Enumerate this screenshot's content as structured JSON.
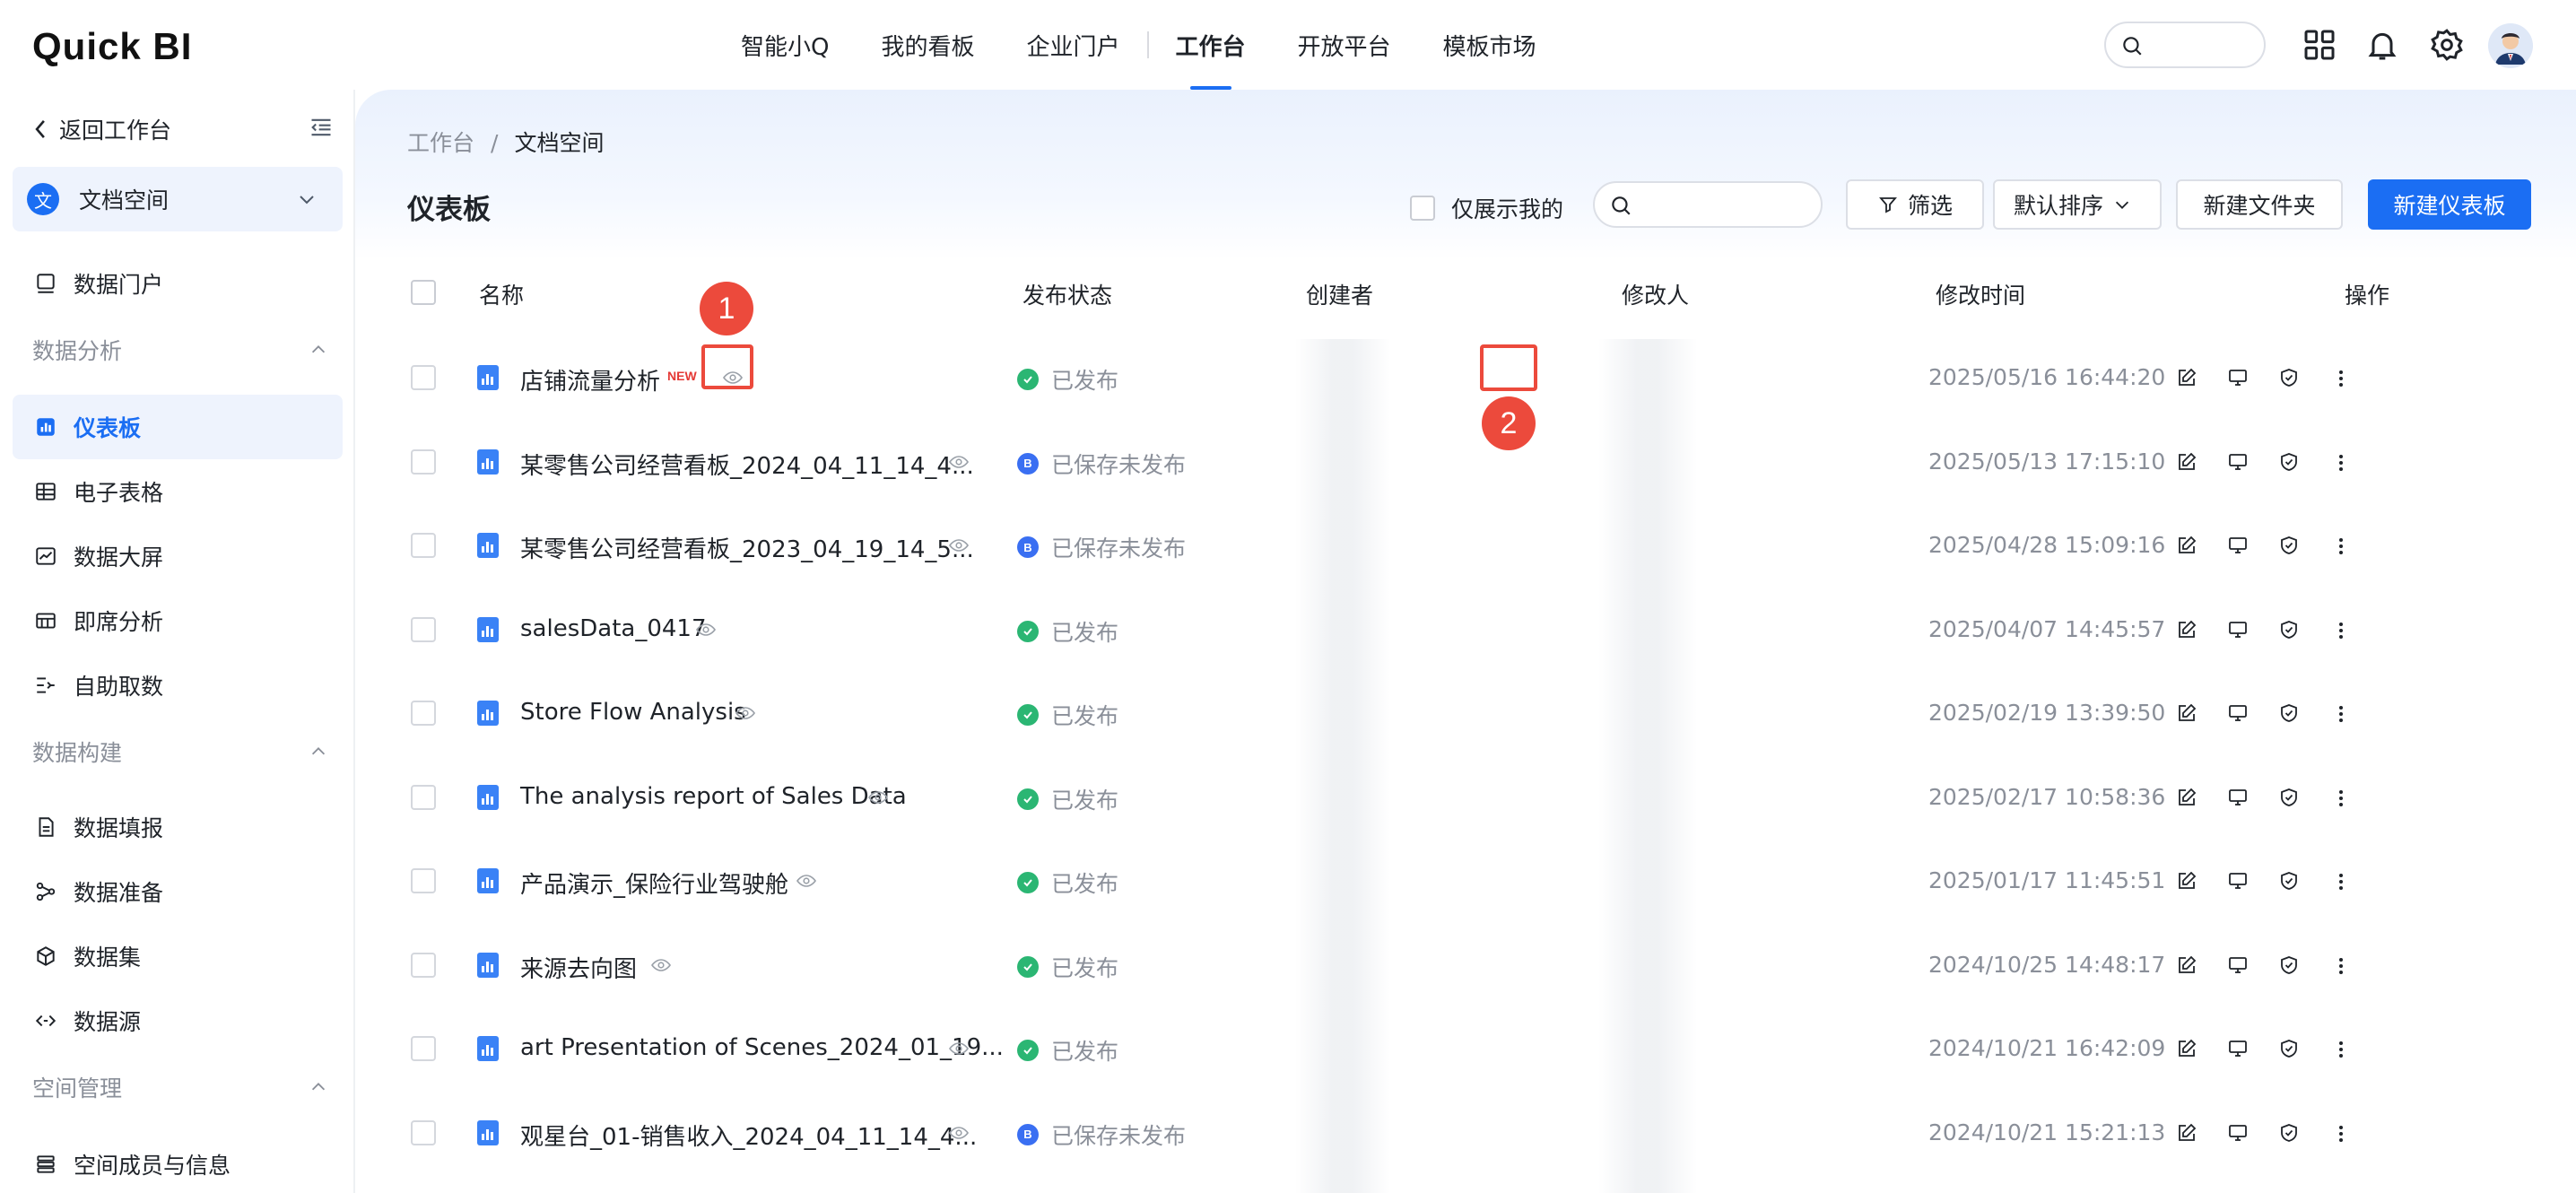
{
  "app": {
    "logo_text": "Quick BI"
  },
  "topnav": {
    "items": [
      {
        "label": "智能小Q"
      },
      {
        "label": "我的看板"
      },
      {
        "label": "企业门户"
      },
      {
        "label": "工作台",
        "active": true
      },
      {
        "label": "开放平台"
      },
      {
        "label": "模板市场"
      }
    ],
    "icons": [
      "search-icon",
      "apps-grid-icon",
      "bell-icon",
      "gear-icon",
      "avatar"
    ]
  },
  "sidebar": {
    "back_label": "返回工作台",
    "space": {
      "badge": "文",
      "label": "文档空间"
    },
    "portal_label": "数据门户",
    "group_analysis": "数据分析",
    "analysis_items": [
      {
        "label": "仪表板",
        "icon": "dashboard-icon",
        "active": true
      },
      {
        "label": "电子表格",
        "icon": "table-icon"
      },
      {
        "label": "数据大屏",
        "icon": "screen-chart-icon"
      },
      {
        "label": "即席分析",
        "icon": "adhoc-icon"
      },
      {
        "label": "自助取数",
        "icon": "self-service-icon"
      }
    ],
    "group_build": "数据构建",
    "build_items": [
      {
        "label": "数据填报",
        "icon": "form-icon"
      },
      {
        "label": "数据准备",
        "icon": "data-prep-icon"
      },
      {
        "label": "数据集",
        "icon": "cube-icon"
      },
      {
        "label": "数据源",
        "icon": "source-icon"
      }
    ],
    "group_space": "空间管理",
    "space_items": [
      {
        "label": "空间成员与信息",
        "icon": "members-icon"
      }
    ]
  },
  "main": {
    "breadcrumb": {
      "root": "工作台",
      "separator": "/",
      "current": "文档空间"
    },
    "title": "仪表板",
    "only_mine_label": "仅展示我的",
    "filter_label": "筛选",
    "sort_label": "默认排序",
    "new_folder_label": "新建文件夹",
    "new_dashboard_label": "新建仪表板",
    "columns": {
      "name": "名称",
      "status": "发布状态",
      "creator": "创建者",
      "modifier": "修改人",
      "mtime": "修改时间",
      "ops": "操作"
    },
    "new_tag": "NEW",
    "rows": [
      {
        "name": "店铺流量分析",
        "status": "已发布",
        "published": true,
        "mtime": "2025/05/16 16:44:20",
        "is_new": true
      },
      {
        "name": "某零售公司经营看板_2024_04_11_14_4...",
        "status": "已保存未发布",
        "published": false,
        "mtime": "2025/05/13 17:15:10"
      },
      {
        "name": "某零售公司经营看板_2023_04_19_14_5...",
        "status": "已保存未发布",
        "published": false,
        "mtime": "2025/04/28 15:09:16"
      },
      {
        "name": "salesData_0417",
        "status": "已发布",
        "published": true,
        "mtime": "2025/04/07 14:45:57"
      },
      {
        "name": "Store Flow Analysis",
        "status": "已发布",
        "published": true,
        "mtime": "2025/02/19 13:39:50"
      },
      {
        "name": "The analysis report of Sales Data",
        "status": "已发布",
        "published": true,
        "mtime": "2025/02/17 10:58:36"
      },
      {
        "name": "产品演示_保险行业驾驶舱",
        "status": "已发布",
        "published": true,
        "mtime": "2025/01/17 11:45:51"
      },
      {
        "name": "来源去向图",
        "status": "已发布",
        "published": true,
        "mtime": "2024/10/25 14:48:17"
      },
      {
        "name": "art Presentation of Scenes_2024_01_19...",
        "status": "已发布",
        "published": true,
        "mtime": "2024/10/21 16:42:09"
      },
      {
        "name": "观星台_01-销售收入_2024_04_11_14_4...",
        "status": "已保存未发布",
        "published": false,
        "mtime": "2024/10/21 15:21:13"
      }
    ],
    "row_op_icons": [
      "edit-icon",
      "preview-screen-icon",
      "shield-check-icon",
      "more-vertical-icon"
    ]
  },
  "annotations": {
    "marker_1": "1",
    "marker_2": "2",
    "color": "#ec4a3c"
  },
  "colors": {
    "accent": "#1b6ef3",
    "published": "#2bb673",
    "unpublished": "#3a6ff2"
  }
}
